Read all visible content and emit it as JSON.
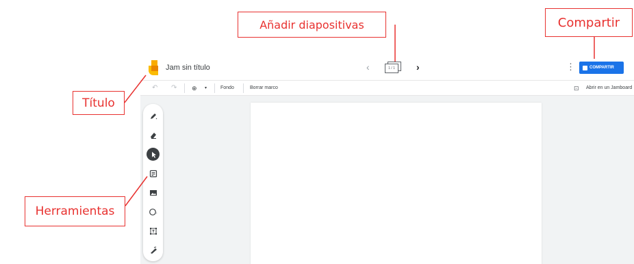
{
  "app": {
    "title": "Jam sin título",
    "frame_counter": "1 / 1",
    "share_label": "COMPARTIR",
    "toolbar": {
      "background_label": "Fondo",
      "clear_frame_label": "Borrar marco",
      "open_jamboard_label": "Abrir en un Jamboard"
    },
    "tools": [
      {
        "icon": "pen-icon"
      },
      {
        "icon": "eraser-icon"
      },
      {
        "icon": "select-cursor-icon",
        "active": true
      },
      {
        "icon": "sticky-note-icon"
      },
      {
        "icon": "image-icon"
      },
      {
        "icon": "circle-shape-icon"
      },
      {
        "icon": "text-box-icon"
      },
      {
        "icon": "laser-icon"
      }
    ]
  },
  "annotations": {
    "slides_label": "Añadir diapositivas",
    "share_label": "Compartir",
    "title_label": "Título",
    "tools_label": "Herramientas",
    "color": "#e8312f"
  },
  "colors": {
    "accent": "#1a73e8",
    "logo": "#fbbc04",
    "canvas_bg": "#f1f3f4"
  }
}
